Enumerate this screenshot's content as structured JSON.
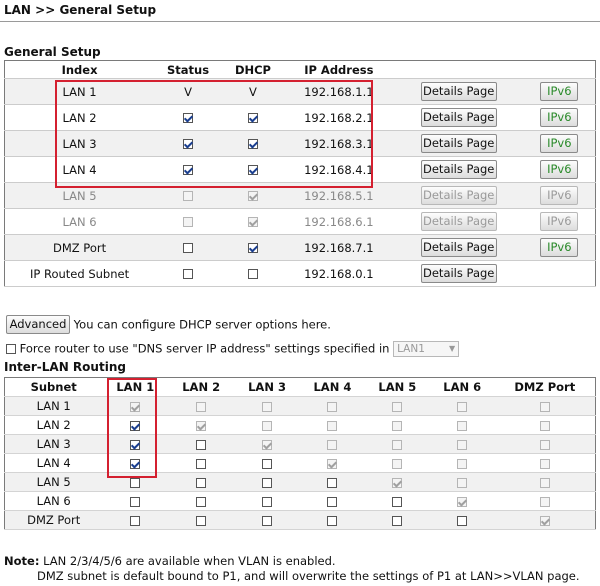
{
  "breadcrumb": "LAN >> General Setup",
  "general_setup": {
    "title": "General Setup",
    "headers": {
      "index": "Index",
      "status": "Status",
      "dhcp": "DHCP",
      "ip": "IP Address"
    },
    "rows": [
      {
        "name": "LAN 1",
        "status_text": "V",
        "dhcp_text": "V",
        "ip": "192.168.1.1",
        "details": "Details Page",
        "ipv6": "IPv6"
      },
      {
        "name": "LAN 2",
        "ip": "192.168.2.1",
        "details": "Details Page",
        "ipv6": "IPv6"
      },
      {
        "name": "LAN 3",
        "ip": "192.168.3.1",
        "details": "Details Page",
        "ipv6": "IPv6"
      },
      {
        "name": "LAN 4",
        "ip": "192.168.4.1",
        "details": "Details Page",
        "ipv6": "IPv6"
      },
      {
        "name": "LAN 5",
        "ip": "192.168.5.1",
        "details": "Details Page",
        "ipv6": "IPv6"
      },
      {
        "name": "LAN 6",
        "ip": "192.168.6.1",
        "details": "Details Page",
        "ipv6": "IPv6"
      },
      {
        "name": "DMZ Port",
        "ip": "192.168.7.1",
        "details": "Details Page",
        "ipv6": "IPv6"
      },
      {
        "name": "IP Routed Subnet",
        "ip": "192.168.0.1",
        "details": "Details Page"
      }
    ]
  },
  "advanced": {
    "button": "Advanced",
    "text": "You can configure DHCP server options here."
  },
  "force_dns": {
    "label": "Force router to use \"DNS server IP address\" settings specified in",
    "select_value": "LAN1"
  },
  "inter_lan": {
    "title": "Inter-LAN Routing",
    "headers": [
      "Subnet",
      "LAN 1",
      "LAN 2",
      "LAN 3",
      "LAN 4",
      "LAN 5",
      "LAN 6",
      "DMZ Port"
    ],
    "rows": [
      "LAN 1",
      "LAN 2",
      "LAN 3",
      "LAN 4",
      "LAN 5",
      "LAN 6",
      "DMZ Port"
    ]
  },
  "note": {
    "label": "Note:",
    "line1": "LAN 2/3/4/5/6 are available when VLAN is enabled.",
    "line2": "DMZ subnet is default bound to P1, and will overwrite the settings of P1 at LAN>>VLAN page."
  },
  "colors": {
    "highlight_box": "#d42030",
    "ipv6_text": "#2a8a2a"
  }
}
